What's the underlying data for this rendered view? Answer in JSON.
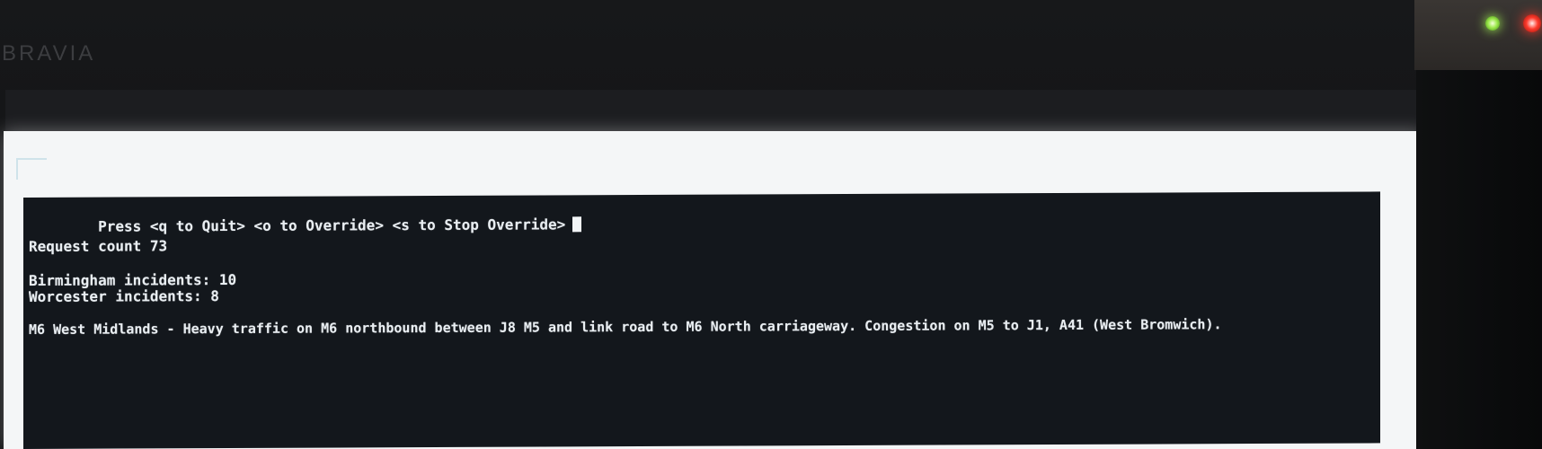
{
  "tv": {
    "brand": "BRAVIA"
  },
  "terminal": {
    "prompt": "Press <q to Quit> <o to Override> <s to Stop Override>",
    "request_count": "Request count 73",
    "birmingham": "Birmingham incidents: 10",
    "worcester": "Worcester incidents: 8",
    "headline": "M6 West Midlands - Heavy traffic on M6 northbound between J8 M5 and link road to M6 North carriageway. Congestion on M5 to J1, A41 (West Bromwich)."
  },
  "colors": {
    "terminal_bg": "#13171c",
    "terminal_text": "#e9eef2",
    "led_green": "#9be84a",
    "led_red": "#ff3a2c"
  }
}
